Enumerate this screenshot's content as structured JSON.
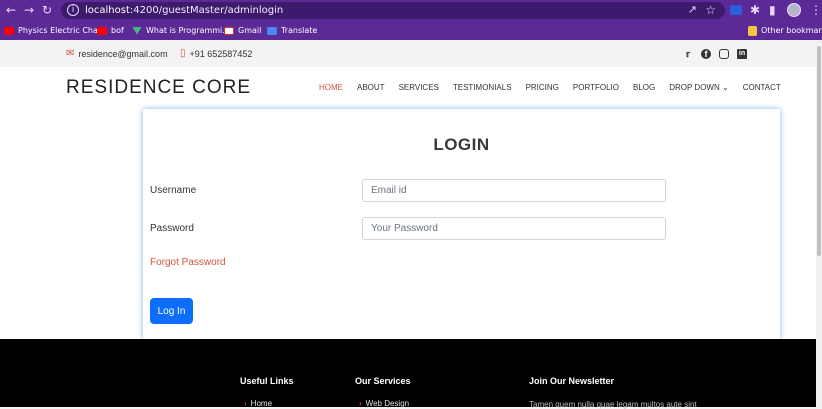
{
  "browser": {
    "url_host": "localhost",
    "url_path": ":4200/guestMaster/adminlogin",
    "bookmarks": [
      {
        "label": "Physics Electric Cha...",
        "icon": "youtube-icon"
      },
      {
        "label": "bof",
        "icon": "youtube-icon"
      },
      {
        "label": "What is Programmi...",
        "icon": "vue-icon"
      },
      {
        "label": "Gmail",
        "icon": "gmail-icon"
      },
      {
        "label": "Translate",
        "icon": "translate-icon"
      }
    ],
    "other_bookmarks": "Other bookmarks"
  },
  "topbar": {
    "email": "residence@gmail.com",
    "phone": "+91 652587452",
    "social": [
      "twitter-icon",
      "facebook-icon",
      "instagram-icon",
      "linkedin-icon"
    ]
  },
  "header": {
    "logo": "RESIDENCE CORE",
    "nav": [
      "HOME",
      "ABOUT",
      "SERVICES",
      "TESTIMONIALS",
      "PRICING",
      "PORTFOLIO",
      "BLOG",
      "DROP DOWN",
      "CONTACT"
    ]
  },
  "login": {
    "title": "LOGIN",
    "username_label": "Username",
    "username_placeholder": "Email id",
    "password_label": "Password",
    "password_placeholder": "Your Password",
    "forgot": "Forgot Password",
    "button": "Log In"
  },
  "footer": {
    "useful_links_title": "Useful Links",
    "useful_link_1": "Home",
    "services_title": "Our Services",
    "service_1": "Web Design",
    "newsletter_title": "Join Our Newsletter",
    "newsletter_text": "Tamen quem nulla quae legam multos aute sint"
  },
  "colors": {
    "accent": "#d2553d",
    "primary_button": "#0d6efd",
    "chrome": "#5b2a97"
  }
}
